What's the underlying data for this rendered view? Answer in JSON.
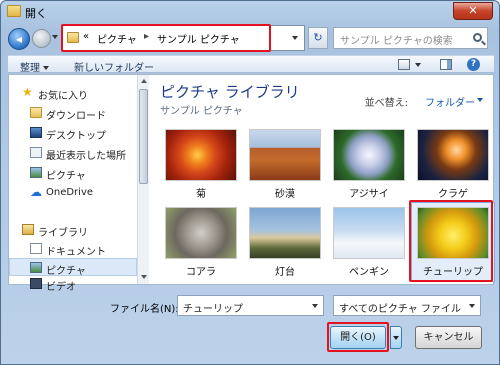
{
  "window": {
    "title": "開く",
    "close_glyph": "✕"
  },
  "address": {
    "prefix": "«",
    "crumb1": "ピクチャ",
    "sep": "▸",
    "crumb2": "サンプル ピクチャ"
  },
  "search": {
    "placeholder": "サンプル ピクチャの検索"
  },
  "toolbar": {
    "organize": "整理",
    "new_folder": "新しいフォルダー",
    "help": "?"
  },
  "sidebar": {
    "favorites": "お気に入り",
    "downloads": "ダウンロード",
    "desktop": "デスクトップ",
    "recent": "最近表示した場所",
    "pictures_fav": "ピクチャ",
    "onedrive": "OneDrive",
    "libraries": "ライブラリ",
    "documents": "ドキュメント",
    "pictures": "ピクチャ",
    "videos": "ビデオ"
  },
  "main": {
    "title": "ピクチャ ライブラリ",
    "subtitle": "サンプル ピクチャ",
    "sort_label": "並べ替え:",
    "sort_value": "フォルダー"
  },
  "files": [
    {
      "name": "菊"
    },
    {
      "name": "砂漠"
    },
    {
      "name": "アジサイ"
    },
    {
      "name": "クラゲ"
    },
    {
      "name": "コアラ"
    },
    {
      "name": "灯台"
    },
    {
      "name": "ペンギン"
    },
    {
      "name": "チューリップ"
    }
  ],
  "footer": {
    "filename_label": "ファイル名(N):",
    "filename_value": "チューリップ",
    "filetype": "すべてのピクチャ ファイル",
    "open": "開く(O)",
    "cancel": "キャンセル"
  },
  "colors": {
    "highlight": "#e4121f",
    "accent": "#1e3b8a"
  }
}
